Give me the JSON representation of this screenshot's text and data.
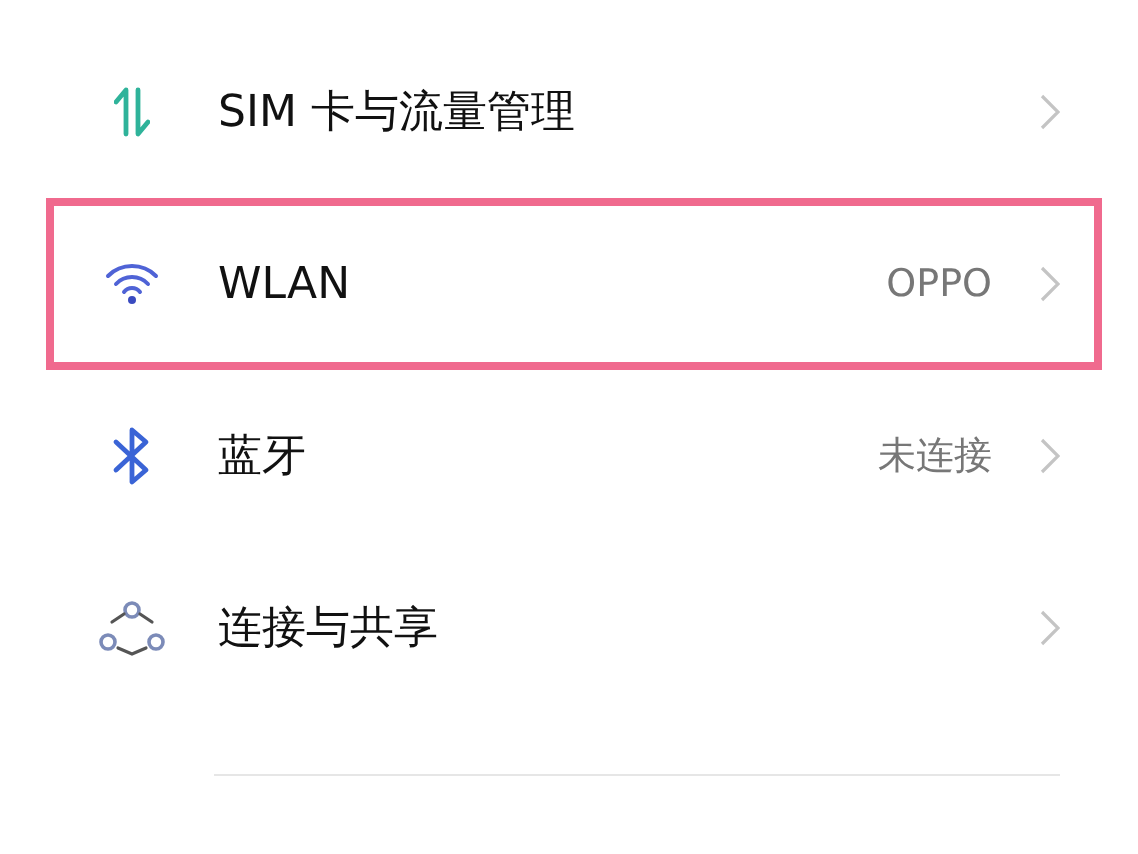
{
  "settings": [
    {
      "kind": "data",
      "label": "SIM 卡与流量管理",
      "highlighted": false
    },
    {
      "kind": "wifi",
      "label": "WLAN",
      "value": "OPPO",
      "highlighted": true
    },
    {
      "kind": "bluetooth",
      "label": "蓝牙",
      "value": "未连接",
      "highlighted": false
    },
    {
      "kind": "share",
      "label": "连接与共享",
      "highlighted": false
    }
  ]
}
